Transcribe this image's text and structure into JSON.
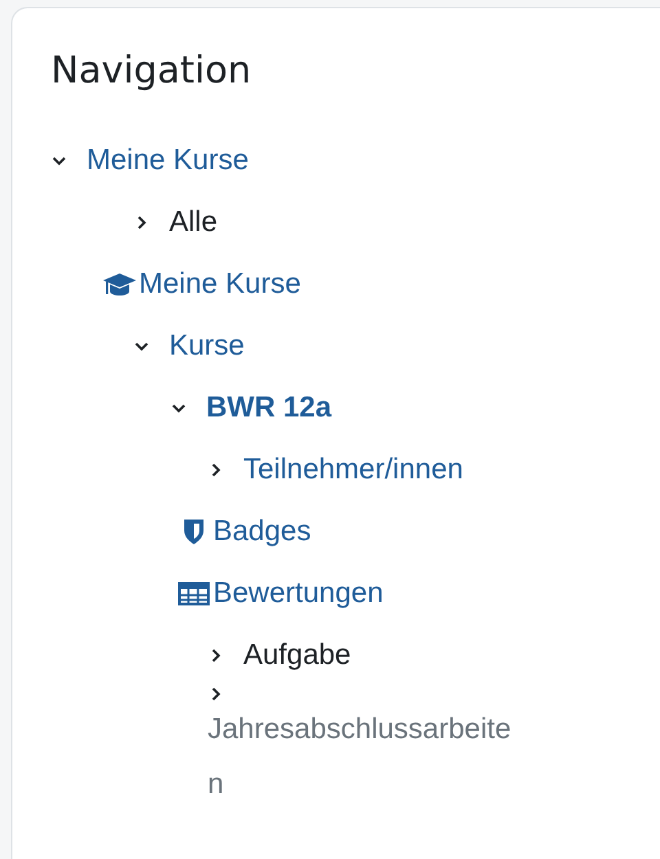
{
  "block": {
    "title": "Navigation"
  },
  "tree": [
    {
      "label": "Meine Kurse",
      "kind": "branch",
      "expanded": true,
      "link": true,
      "disabled": false,
      "current": false,
      "children": [
        {
          "label": "Alle",
          "kind": "branch",
          "expanded": false,
          "link": false,
          "disabled": false,
          "current": false
        },
        {
          "label": "Meine Kurse",
          "kind": "courses",
          "link": true,
          "disabled": false,
          "current": false
        },
        {
          "label": "Kurse",
          "kind": "branch",
          "expanded": true,
          "link": true,
          "disabled": false,
          "current": false,
          "children": [
            {
              "label": "BWR 12a",
              "kind": "branch",
              "expanded": true,
              "link": true,
              "disabled": false,
              "current": true,
              "children": [
                {
                  "label": "Teilnehmer/innen",
                  "kind": "branch",
                  "expanded": false,
                  "link": true,
                  "disabled": false,
                  "current": false
                },
                {
                  "label": "Badges",
                  "kind": "badges",
                  "link": true,
                  "disabled": false,
                  "current": false
                },
                {
                  "label": "Bewertungen",
                  "kind": "grades",
                  "link": true,
                  "disabled": false,
                  "current": false
                },
                {
                  "label": "Aufgabe",
                  "kind": "branch",
                  "expanded": false,
                  "link": false,
                  "disabled": false,
                  "current": false
                },
                {
                  "label": "Jahresabschlussarbeiten",
                  "kind": "branch",
                  "expanded": false,
                  "disabled": true,
                  "current": false
                }
              ]
            }
          ]
        }
      ]
    }
  ]
}
